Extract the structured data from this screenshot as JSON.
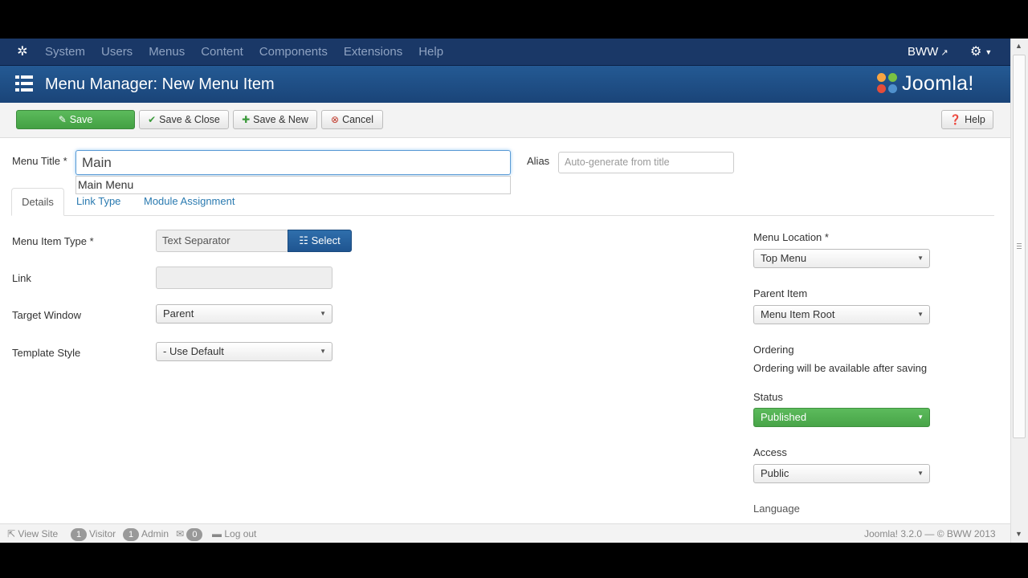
{
  "topnav": {
    "menu": [
      "System",
      "Users",
      "Menus",
      "Content",
      "Components",
      "Extensions",
      "Help"
    ],
    "user": "BWW",
    "icons": {
      "logo": "joomla-logo",
      "user_link": "external-link-icon",
      "settings": "gear-icon"
    }
  },
  "header": {
    "title": "Menu Manager: New Menu Item",
    "brand": "Joomla!"
  },
  "toolbar": {
    "save": "Save",
    "save_close": "Save & Close",
    "save_new": "Save & New",
    "cancel": "Cancel",
    "help": "Help"
  },
  "form": {
    "menu_title_label": "Menu Title *",
    "menu_title_value": "Main",
    "alias_label": "Alias",
    "alias_placeholder": "Auto-generate from title",
    "autocomplete_option": "Main Menu"
  },
  "tabs": [
    "Details",
    "Link Type",
    "Module Assignment"
  ],
  "details": {
    "menu_item_type_label": "Menu Item Type *",
    "menu_item_type_value": "Text Separator",
    "select_button": "Select",
    "link_label": "Link",
    "link_value": "",
    "target_window_label": "Target Window",
    "target_window_value": "Parent",
    "template_style_label": "Template Style",
    "template_style_value": "- Use Default"
  },
  "sidebar": {
    "menu_location_label": "Menu Location *",
    "menu_location_value": "Top Menu",
    "parent_item_label": "Parent Item",
    "parent_item_value": "Menu Item Root",
    "ordering_label": "Ordering",
    "ordering_text": "Ordering will be available after saving",
    "status_label": "Status",
    "status_value": "Published",
    "access_label": "Access",
    "access_value": "Public",
    "language_label": "Language"
  },
  "footer": {
    "view_site": "View Site",
    "visitor_count": "1",
    "visitor_label": "Visitor",
    "admin_count": "1",
    "admin_label": "Admin",
    "messages_count": "0",
    "logout": "Log out",
    "version": "Joomla! 3.2.0 — © BWW 2013"
  },
  "colors": {
    "nav_bg": "#1a3867",
    "header_bg": "#1e4d86",
    "save_green": "#4cae4c",
    "select_blue": "#2a6aa8",
    "link_blue": "#2a7ab0"
  }
}
